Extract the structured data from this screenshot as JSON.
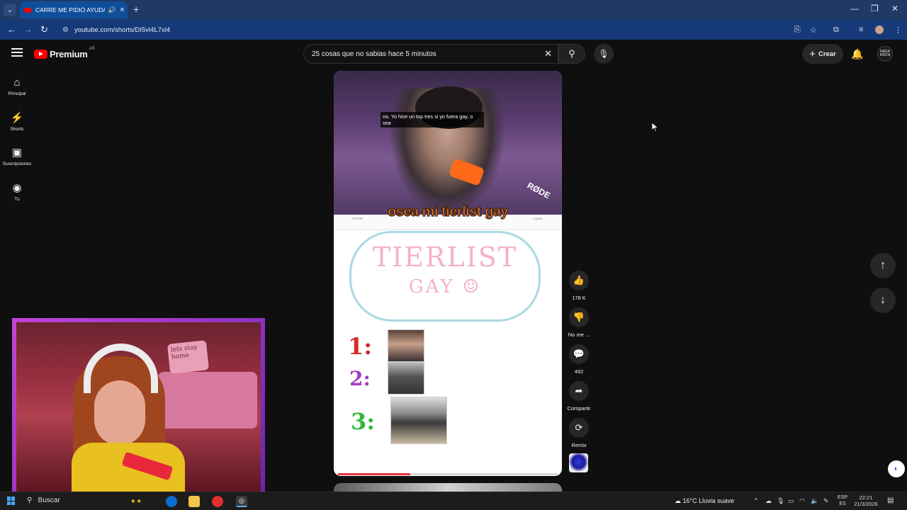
{
  "browser": {
    "tab_title": "CARRE ME PIDIÓ AYUDA PA",
    "url": "youtube.com/shorts/DI5vl4L7xl4",
    "new_tab_label": "+",
    "minimize": "—",
    "restore": "❐",
    "close": "✕"
  },
  "youtube": {
    "logo_text": "Premium",
    "country_code": "AR",
    "search_value": "25 cosas que no sabias hace 5 minutos",
    "create_label": "Crear",
    "account_initials": "NADA INSTA"
  },
  "sidebar": {
    "items": [
      {
        "label": "Principal",
        "icon": "home-icon"
      },
      {
        "label": "Shorts",
        "icon": "shorts-icon"
      },
      {
        "label": "Suscripciones",
        "icon": "subscriptions-icon"
      },
      {
        "label": "Tú",
        "icon": "you-icon"
      }
    ]
  },
  "short": {
    "subtitle_text": "no. Yo hice un top tres si yo fuera gay, o sea",
    "caption": "osea mi tierlist gay",
    "rode_brand": "RØDE",
    "strip_left": "Formas",
    "strip_right": "Capas",
    "tier_title": "TIERLIST",
    "tier_sub": "GAY ☺",
    "ranks": [
      "1:",
      "2:",
      "3:"
    ],
    "progress_fraction": 0.33
  },
  "actions": {
    "like_count": "178 K",
    "dislike_label": "No me ...",
    "comment_count": "492",
    "share_label": "Compartir",
    "remix_label": "Remix"
  },
  "webcam": {
    "pillow_text": "lets stay home"
  },
  "taskbar": {
    "search_label": "Buscar",
    "weather": "16°C  Lluvia suave",
    "lang_top": "ESP",
    "lang_bottom": "ES",
    "time": "22:21",
    "date": "21/3/2026"
  },
  "colors": {
    "accent_red": "#ff0000",
    "caption_orange": "#f07d2a",
    "tier_pink": "#f4b2c4",
    "cloud_blue": "#a9d9e2",
    "rank1": "#d62a2a",
    "rank2": "#a43cc0",
    "rank3": "#2fb83c"
  }
}
